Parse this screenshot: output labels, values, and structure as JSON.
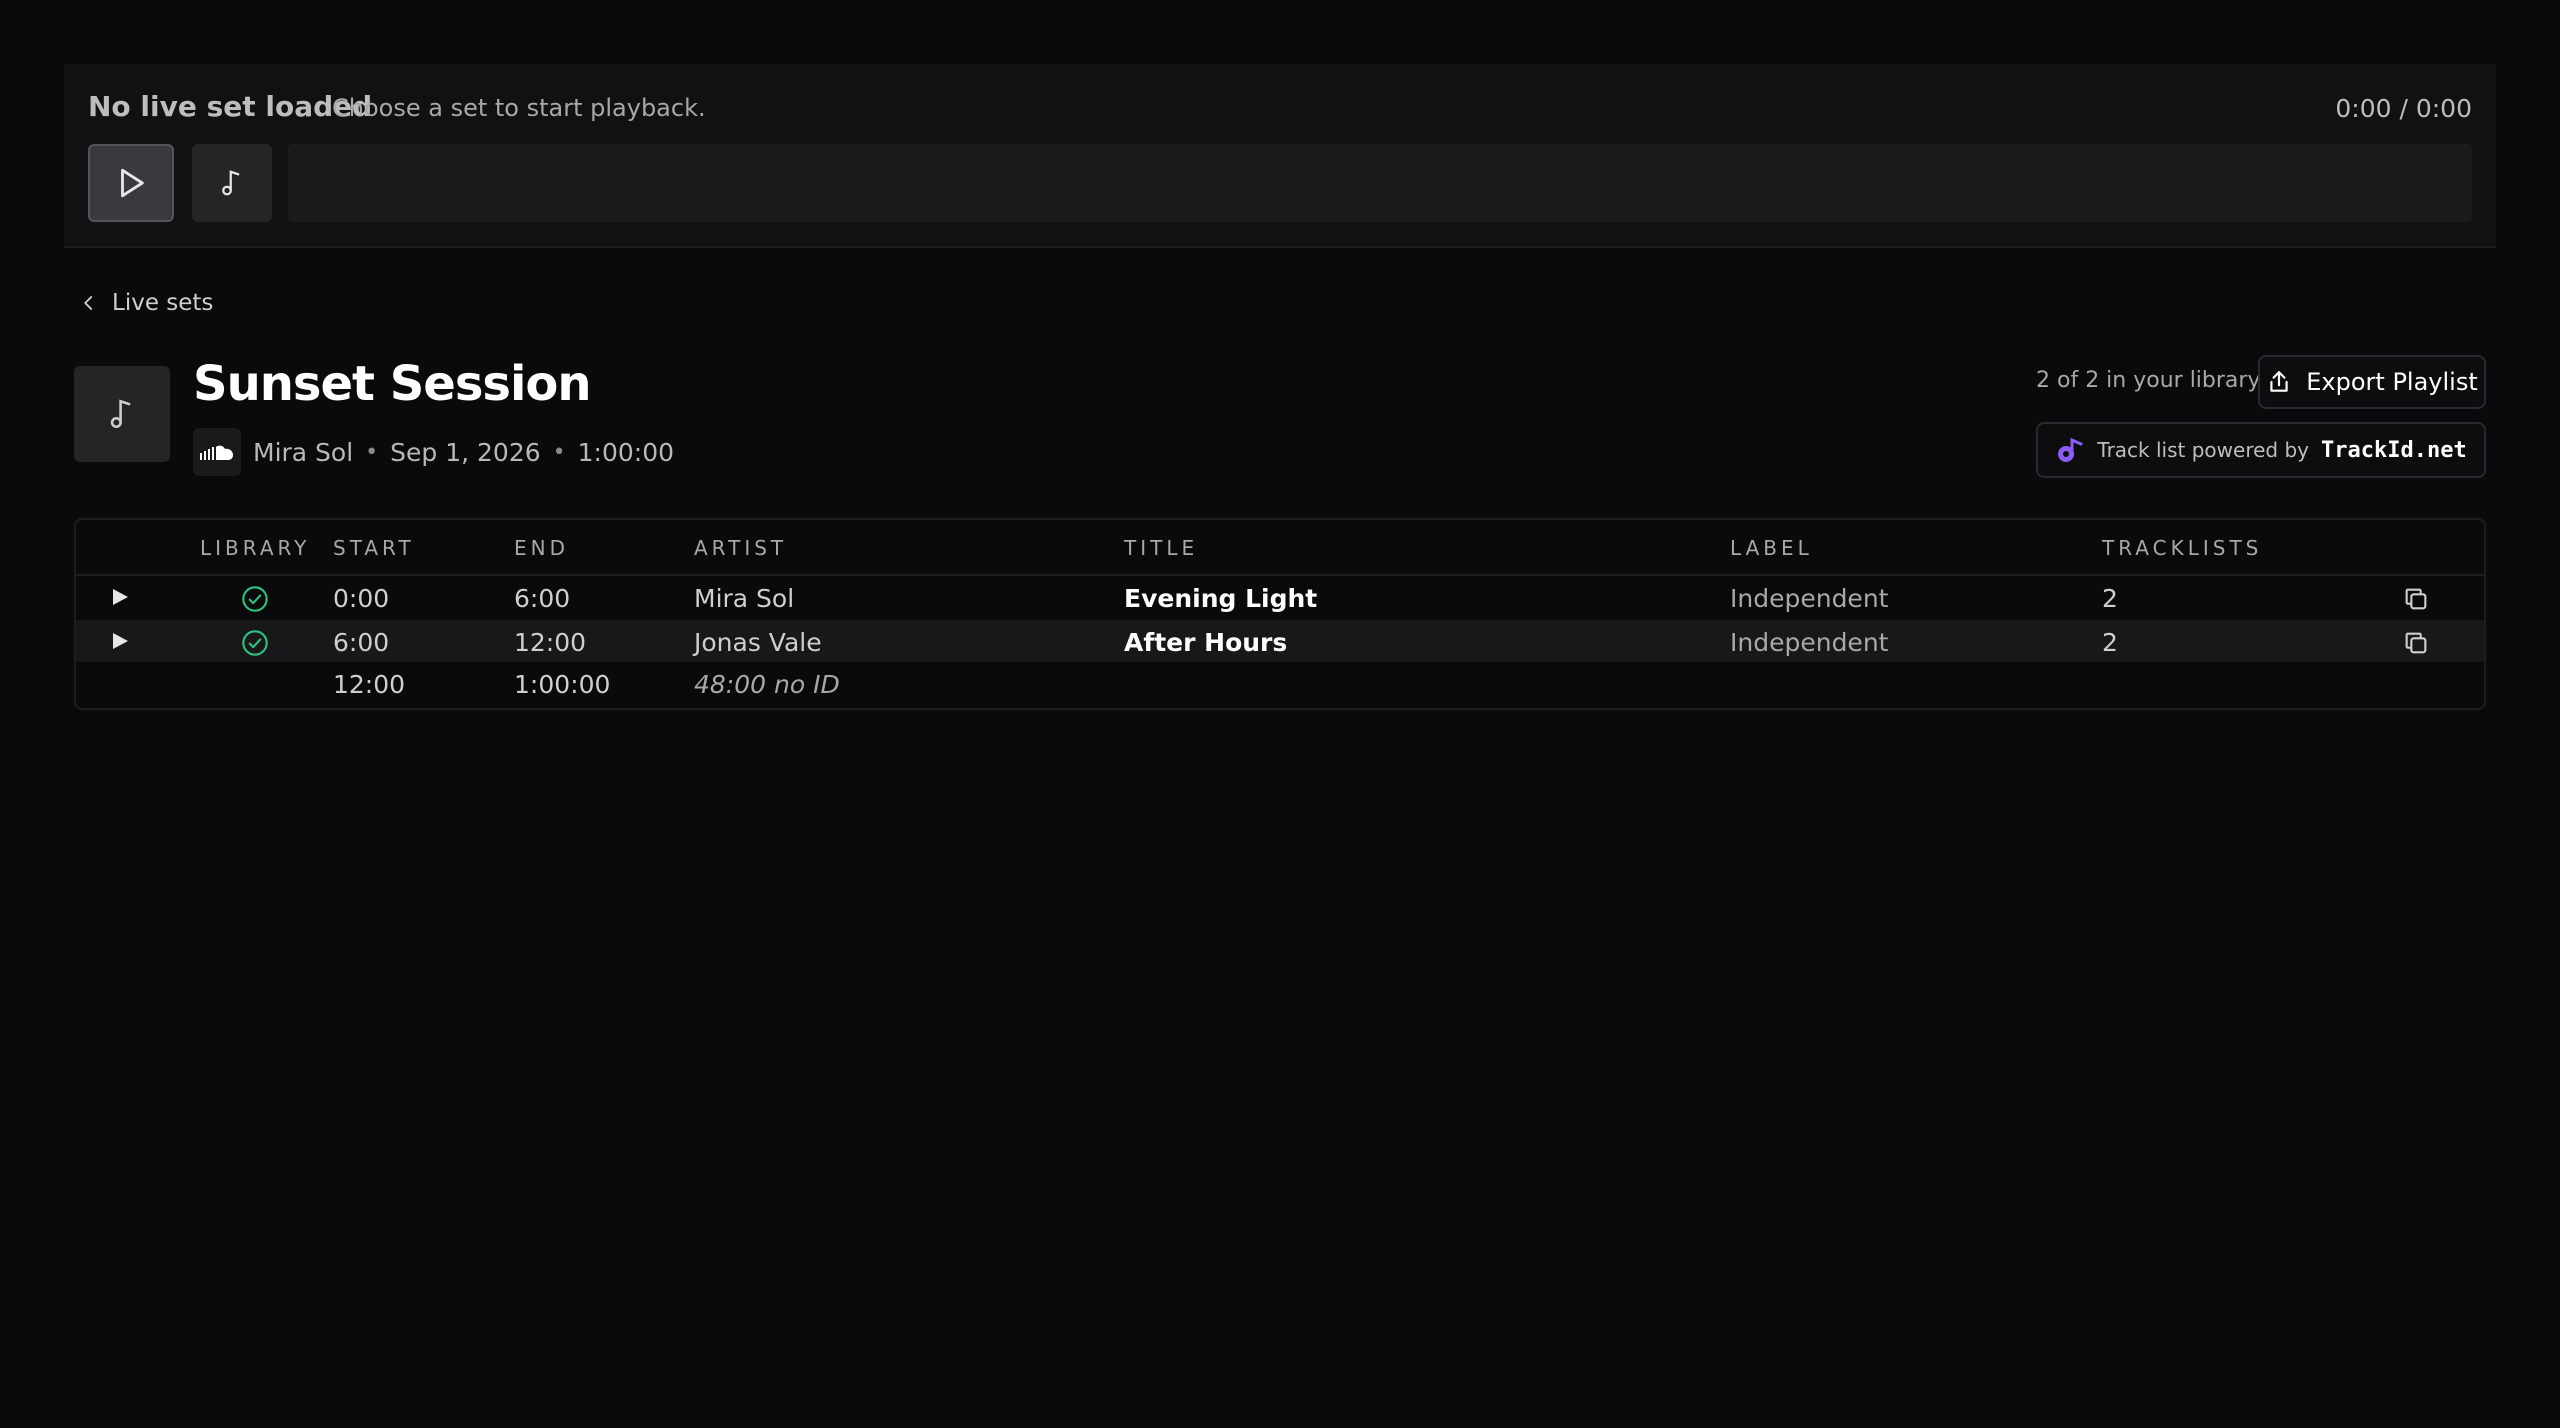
{
  "player": {
    "title": "No live set loaded",
    "subtitle": "Choose a set to start playback.",
    "time": "0:00 / 0:00"
  },
  "nav": {
    "back_label": "Live sets"
  },
  "set": {
    "title": "Sunset Session",
    "artist": "Mira Sol",
    "date": "Sep 1, 2026",
    "duration": "1:00:00",
    "library_count": "2 of 2 in your library",
    "export_label": "Export Playlist",
    "powered_by": "Track list powered by",
    "powered_brand": "TrackId.net"
  },
  "table": {
    "headers": {
      "library": "LIBRARY",
      "start": "START",
      "end": "END",
      "artist": "ARTIST",
      "title": "TITLE",
      "label": "LABEL",
      "tracklists": "TRACKLISTS"
    },
    "rows": [
      {
        "start": "0:00",
        "end": "6:00",
        "artist": "Mira Sol",
        "title": "Evening Light",
        "label": "Independent",
        "tracklists": "2",
        "in_library": true
      },
      {
        "start": "6:00",
        "end": "12:00",
        "artist": "Jonas Vale",
        "title": "After Hours",
        "label": "Independent",
        "tracklists": "2",
        "in_library": true
      }
    ],
    "gap_row": {
      "start": "12:00",
      "end": "1:00:00",
      "note": "48:00 no ID"
    }
  },
  "colors": {
    "background": "#0a0a0c",
    "library_check": "#2ec27e",
    "brand_purple": "#8b5cf6"
  },
  "icons": {
    "play": "play-icon",
    "note": "music-note-icon",
    "back": "chevron-left-icon",
    "soundcloud": "soundcloud-icon",
    "export": "share-upload-icon",
    "check": "check-circle-icon",
    "copy": "copy-icon",
    "brand": "trackid-logo-icon"
  }
}
